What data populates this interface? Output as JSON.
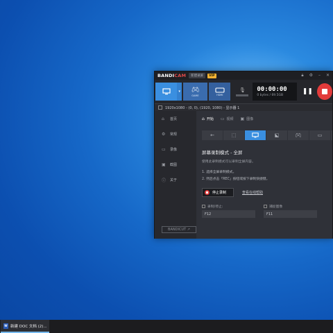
{
  "app": {
    "logo_a": "BANDI",
    "logo_b": "CAM",
    "tag": "新建录屏",
    "vip": "VIP",
    "title_icons": [
      "lock-icon",
      "gear-icon",
      "minimize-icon",
      "close-icon"
    ]
  },
  "toolbar": {
    "modes": [
      "screen-mode",
      "game-mode",
      "device-mode"
    ],
    "game_label": "GAME",
    "device_label": "HDMI",
    "timer": "00:00:00",
    "size": "0 bytes / 69.5GB"
  },
  "area": {
    "text": "1920x1080 - (0, 0), (1920, 1080) - 显示器 1"
  },
  "sidebar": {
    "items": [
      {
        "label": "首页",
        "icon": "home-icon"
      },
      {
        "label": "常规",
        "icon": "gear-icon"
      },
      {
        "label": "录像",
        "icon": "video-icon"
      },
      {
        "label": "截图",
        "icon": "image-icon"
      },
      {
        "label": "关于",
        "icon": "info-icon"
      }
    ],
    "bandicut": "BANDICUT ↗"
  },
  "tabs": [
    {
      "label": "开始",
      "active": true
    },
    {
      "label": "视频",
      "active": false
    },
    {
      "label": "图像",
      "active": false
    }
  ],
  "content": {
    "heading": "屏幕录制模式 - 全屏",
    "desc": "使用此录制模式可以录制全屏内容。",
    "step1": "1. 选择全屏录制模式。",
    "step2": "2. 然后点击「REC」按钮或按下录制快捷键。",
    "stop_label": "停止录制",
    "help_link": "查看在线帮助",
    "hotkeys": [
      {
        "label": "录制/停止:",
        "value": "F12"
      },
      {
        "label": "捕捉图像",
        "value": "F11"
      }
    ]
  },
  "taskbar": {
    "item": "新建 DOC 文档 (2)..."
  },
  "colors": {
    "accent": "#3a8fe0",
    "rec": "#e23b3b",
    "vip": "#f2b233"
  }
}
